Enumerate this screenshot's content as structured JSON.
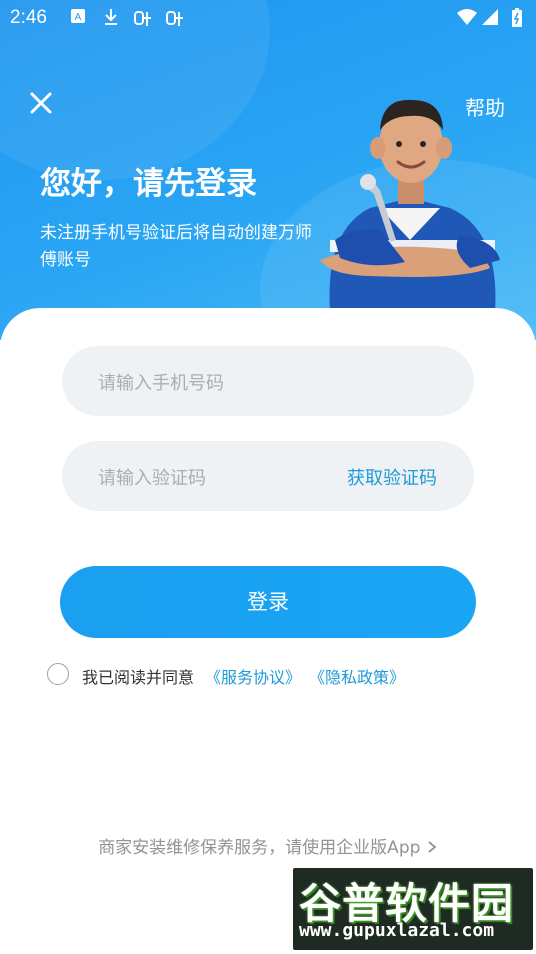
{
  "status_bar": {
    "time": "2:46"
  },
  "header": {
    "help_label": "帮助",
    "title": "您好，请先登录",
    "subtitle": "未注册手机号验证后将自动创建万师傅账号"
  },
  "form": {
    "phone_placeholder": "请输入手机号码",
    "code_placeholder": "请输入验证码",
    "get_code_label": "获取验证码",
    "login_label": "登录"
  },
  "agreement": {
    "prefix": "我已阅读并同意",
    "service_link": "《服务协议》",
    "privacy_link": "《隐私政策》",
    "checked": false
  },
  "footer": {
    "enterprise_link": "商家安装维修保养服务，请使用企业版App"
  },
  "watermark": {
    "title": "谷普软件园",
    "url": "www.gupuxlazal.com"
  },
  "colors": {
    "primary": "#1b9ff0",
    "link": "#1f9ad8",
    "field_bg": "#eef2f4"
  }
}
